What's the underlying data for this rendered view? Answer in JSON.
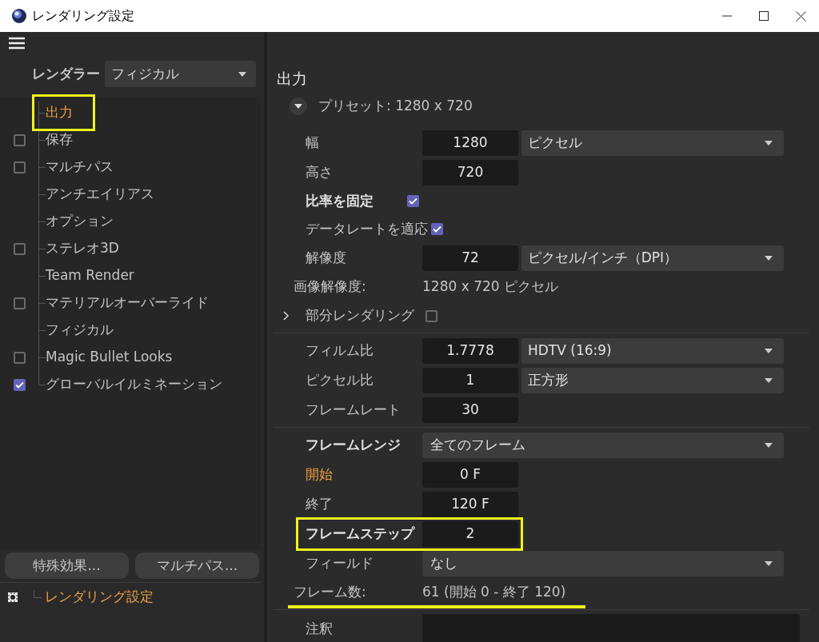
{
  "window": {
    "title": "レンダリング設定"
  },
  "renderer": {
    "label": "レンダラー",
    "value": "フィジカル"
  },
  "tree": [
    {
      "label": "出力",
      "kind": "plain",
      "selected": true,
      "highlighted": true
    },
    {
      "label": "保存",
      "kind": "check",
      "checked": false,
      "selected": false,
      "highlighted": false
    },
    {
      "label": "マルチパス",
      "kind": "check",
      "checked": false,
      "selected": false,
      "highlighted": false
    },
    {
      "label": "アンチエイリアス",
      "kind": "plain",
      "selected": false,
      "highlighted": false
    },
    {
      "label": "オプション",
      "kind": "plain",
      "selected": false,
      "highlighted": false
    },
    {
      "label": "ステレオ3D",
      "kind": "check",
      "checked": false,
      "selected": false,
      "highlighted": false
    },
    {
      "label": "Team Render",
      "kind": "plain",
      "selected": false,
      "highlighted": false
    },
    {
      "label": "マテリアルオーバーライド",
      "kind": "check",
      "checked": false,
      "selected": false,
      "highlighted": false
    },
    {
      "label": "フィジカル",
      "kind": "plain",
      "selected": false,
      "highlighted": false
    },
    {
      "label": "Magic Bullet Looks",
      "kind": "check",
      "checked": false,
      "selected": false,
      "highlighted": false
    },
    {
      "label": "グローバルイルミネーション",
      "kind": "check",
      "checked": true,
      "selected": false,
      "highlighted": false
    }
  ],
  "buttons": [
    "特殊効果...",
    "マルチパス..."
  ],
  "settings_list": [
    {
      "label": "レンダリング設定",
      "selected": true
    }
  ],
  "panel": {
    "title": "出力",
    "preset": {
      "label": "プリセット: 1280 x 720",
      "expanded": true
    },
    "sections": [
      {
        "rows": [
          {
            "kind": "field",
            "label": "幅",
            "value": "1280",
            "dropdown": "ピクセル"
          },
          {
            "kind": "field",
            "label": "高さ",
            "value": "720"
          },
          {
            "kind": "check",
            "label": "比率を固定",
            "checked": true
          },
          {
            "kind": "check",
            "label": "データレートを適応",
            "checked": true
          },
          {
            "kind": "field",
            "label": "解像度",
            "value": "72",
            "dropdown": "ピクセル/インチ（DPI）"
          },
          {
            "kind": "info",
            "label": "画像解像度:",
            "value": "1280 x 720 ピクセル"
          },
          {
            "kind": "group",
            "label": "部分レンダリング",
            "expanded": false,
            "checked": false
          }
        ]
      },
      {
        "rows": [
          {
            "kind": "field",
            "label": "フィルム比",
            "value": "1.7778",
            "dropdown": "HDTV (16:9)"
          },
          {
            "kind": "field",
            "label": "ピクセル比",
            "value": "1",
            "dropdown": "正方形"
          },
          {
            "kind": "field",
            "label": "フレームレート",
            "value": "30"
          }
        ]
      },
      {
        "rows": [
          {
            "kind": "select",
            "label": "フレームレンジ",
            "value": "全てのフレーム"
          },
          {
            "kind": "field",
            "label": "開始",
            "value": "0 F"
          },
          {
            "kind": "field",
            "label": "終了",
            "value": "120 F"
          },
          {
            "kind": "field",
            "label": "フレームステップ",
            "value": "2",
            "highlighted": true
          },
          {
            "kind": "select",
            "label": "フィールド",
            "value": "なし"
          },
          {
            "kind": "info",
            "label": "フレーム数:",
            "value": "61 (開始 0 - 終了 120)",
            "highlighted": true
          }
        ]
      },
      {
        "rows": [
          {
            "kind": "notes",
            "label": "注釈"
          }
        ]
      }
    ]
  }
}
